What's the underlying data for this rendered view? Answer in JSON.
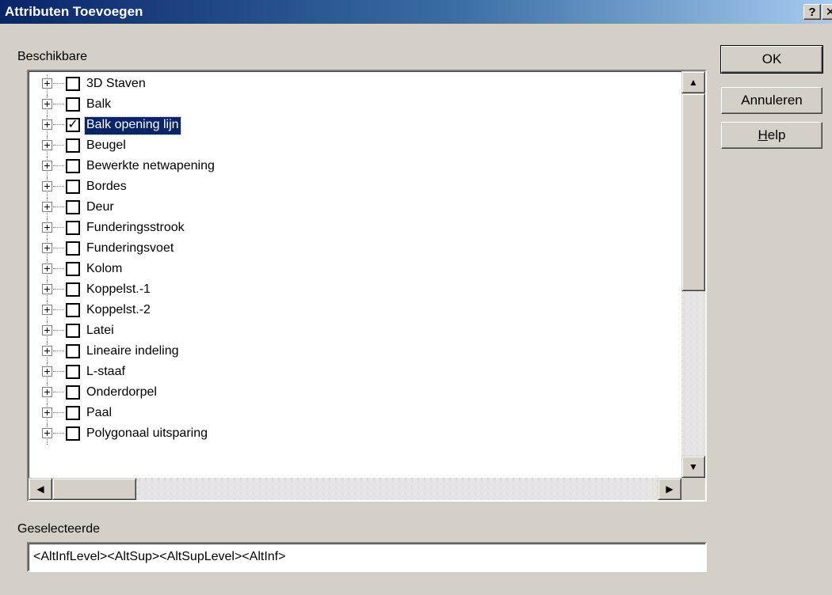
{
  "window": {
    "title": "Attributen Toevoegen",
    "help_glyph": "?",
    "close_glyph": "✕"
  },
  "labels": {
    "available": "Beschikbare",
    "selected": "Geselecteerde"
  },
  "tree": {
    "items": [
      {
        "label": "3D Staven",
        "checked": false,
        "selected": false
      },
      {
        "label": "Balk",
        "checked": false,
        "selected": false
      },
      {
        "label": "Balk opening lijn",
        "checked": true,
        "selected": true
      },
      {
        "label": "Beugel",
        "checked": false,
        "selected": false
      },
      {
        "label": "Bewerkte netwapening",
        "checked": false,
        "selected": false
      },
      {
        "label": "Bordes",
        "checked": false,
        "selected": false
      },
      {
        "label": "Deur",
        "checked": false,
        "selected": false
      },
      {
        "label": "Funderingsstrook",
        "checked": false,
        "selected": false
      },
      {
        "label": "Funderingsvoet",
        "checked": false,
        "selected": false
      },
      {
        "label": "Kolom",
        "checked": false,
        "selected": false
      },
      {
        "label": "Koppelst.-1",
        "checked": false,
        "selected": false
      },
      {
        "label": "Koppelst.-2",
        "checked": false,
        "selected": false
      },
      {
        "label": "Latei",
        "checked": false,
        "selected": false
      },
      {
        "label": "Lineaire indeling",
        "checked": false,
        "selected": false
      },
      {
        "label": "L-staaf",
        "checked": false,
        "selected": false
      },
      {
        "label": "Onderdorpel",
        "checked": false,
        "selected": false
      },
      {
        "label": "Paal",
        "checked": false,
        "selected": false
      },
      {
        "label": "Polygonaal uitsparing",
        "checked": false,
        "selected": false
      }
    ],
    "check_glyph": "✓"
  },
  "scrollbars": {
    "up_glyph": "▲",
    "down_glyph": "▼",
    "left_glyph": "◀",
    "right_glyph": "▶"
  },
  "selected_value": "<AltInfLevel><AltSup><AltSupLevel><AltInf>",
  "buttons": {
    "ok": "OK",
    "cancel": "Annuleren",
    "help_accel": "H",
    "help_rest": "elp"
  }
}
